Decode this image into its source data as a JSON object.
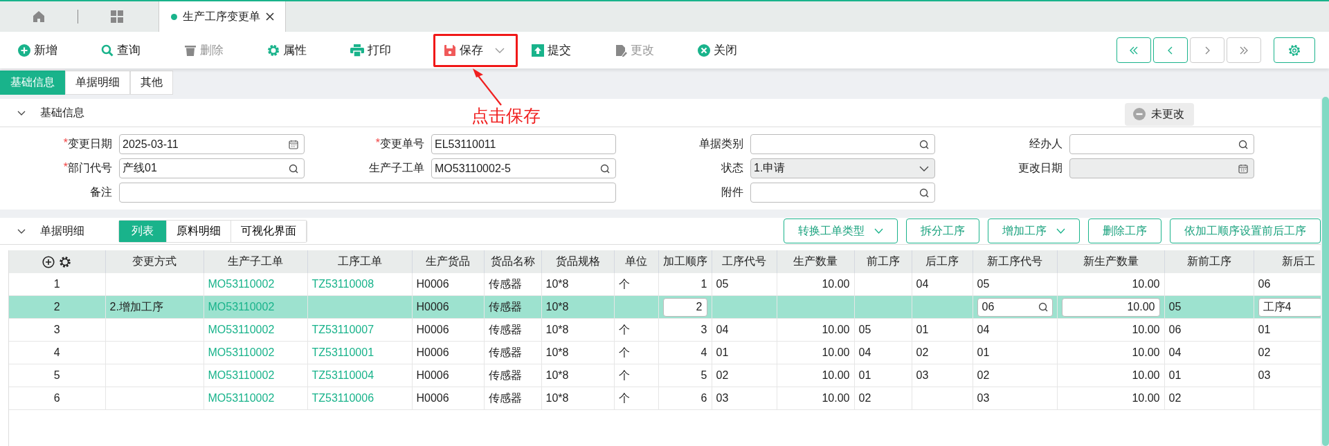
{
  "doc_tabs": [
    {
      "kind": "home",
      "selected": false
    },
    {
      "kind": "grid",
      "selected": false
    },
    {
      "kind": "page",
      "label": "生产工序变更单",
      "selected": true
    }
  ],
  "toolbar": [
    {
      "label": "新增",
      "disabled": false
    },
    {
      "label": "查询",
      "disabled": false
    },
    {
      "label": "删除",
      "disabled": true
    },
    {
      "label": "属性",
      "disabled": false
    },
    {
      "label": "打印",
      "disabled": false
    },
    {
      "label": "保存",
      "disabled": false,
      "dropdown": true,
      "annotated": true
    },
    {
      "label": "提交",
      "disabled": false
    },
    {
      "label": "更改",
      "disabled": true
    },
    {
      "label": "关闭",
      "disabled": false
    }
  ],
  "nav_buttons": [
    {
      "disabled": false
    },
    {
      "disabled": false
    },
    {
      "disabled": true
    },
    {
      "disabled": true
    }
  ],
  "annotation": {
    "text": "点击保存"
  },
  "section_tabs": [
    {
      "label": "基础信息",
      "selected": true
    },
    {
      "label": "单据明细",
      "selected": false
    },
    {
      "label": "其他",
      "selected": false
    }
  ],
  "basic_info": {
    "title": "基础信息",
    "expanded": true,
    "status": "未更改",
    "rows": [
      [
        {
          "required_mark": "*",
          "label": "变更日期",
          "value": "2025-03-11",
          "kind": "date",
          "disabled": false
        },
        {
          "required_mark": "*",
          "label": "变更单号",
          "value": "EL53110011",
          "kind": "text",
          "disabled": false
        },
        {
          "label": "单据类别",
          "kind": "lookup",
          "disabled": false
        },
        {
          "label": "经办人",
          "kind": "lookup",
          "disabled": false
        }
      ],
      [
        {
          "required_mark": "*",
          "label": "部门代号",
          "value": "产线01",
          "kind": "lookup",
          "disabled": false
        },
        {
          "label": "生产子工单",
          "value": "MO53110002-5",
          "kind": "lookup",
          "disabled": false
        },
        {
          "label": "状态",
          "value": "1.申请",
          "kind": "select",
          "disabled": true
        },
        {
          "label": "更改日期",
          "kind": "date",
          "disabled": true
        }
      ],
      [
        {
          "label": "备注",
          "kind": "text",
          "wide": true,
          "disabled": false
        },
        "",
        {
          "label": "附件",
          "kind": "lookup",
          "disabled": false
        }
      ]
    ]
  },
  "detail": {
    "title": "单据明细",
    "expanded": true,
    "view_tabs": [
      {
        "label": "列表",
        "selected": true
      },
      {
        "label": "原料明细",
        "selected": false
      },
      {
        "label": "可视化界面",
        "selected": false
      }
    ],
    "actions": [
      {
        "label": "转换工单类型",
        "dropdown": true
      },
      {
        "label": "拆分工序",
        "dropdown": false
      },
      {
        "label": "增加工序",
        "dropdown": true
      },
      {
        "label": "删除工序",
        "dropdown": false
      },
      {
        "label": "依加工顺序设置前后工序",
        "dropdown": false
      }
    ],
    "columns": [
      {
        "label": "变更方式",
        "kind": "text",
        "editable": false
      },
      {
        "label": "生产子工单",
        "kind": "link",
        "editable": false
      },
      {
        "label": "工序工单",
        "kind": "link",
        "editable": false
      },
      {
        "label": "生产货品",
        "kind": "text",
        "editable": false
      },
      {
        "label": "货品名称",
        "kind": "text",
        "editable": false
      },
      {
        "label": "货品规格",
        "kind": "text",
        "editable": false
      },
      {
        "label": "单位",
        "kind": "text",
        "editable": false
      },
      {
        "label": "加工顺序",
        "kind": "number",
        "editable": true
      },
      {
        "label": "工序代号",
        "kind": "text",
        "editable": false
      },
      {
        "label": "生产数量",
        "kind": "number",
        "editable": false
      },
      {
        "label": "前工序",
        "kind": "text",
        "editable": false
      },
      {
        "label": "后工序",
        "kind": "text",
        "editable": false
      },
      {
        "label": "新工序代号",
        "kind": "lookup",
        "editable": true
      },
      {
        "label": "新生产数量",
        "kind": "number",
        "editable": true
      },
      {
        "label": "新前工序",
        "kind": "text",
        "editable": false
      },
      {
        "label": "新后工",
        "kind": "text",
        "editable": true
      }
    ],
    "rows": [
      {
        "index": "1",
        "selected": false,
        "cells": [
          null,
          "MO53110002",
          "TZ53110008",
          "H0006",
          "传感器",
          "10*8",
          "个",
          "1",
          "05",
          "10.00",
          null,
          "04",
          "05",
          "10.00",
          null,
          "06"
        ]
      },
      {
        "index": "2",
        "selected": true,
        "cells": [
          "2.增加工序",
          "MO53110002",
          null,
          "H0006",
          "传感器",
          "10*8",
          null,
          "2",
          null,
          null,
          null,
          null,
          "06",
          "10.00",
          "05",
          "工序4"
        ]
      },
      {
        "index": "3",
        "selected": false,
        "cells": [
          null,
          "MO53110002",
          "TZ53110007",
          "H0006",
          "传感器",
          "10*8",
          "个",
          "3",
          "04",
          "10.00",
          "05",
          "01",
          "04",
          "10.00",
          "06",
          "01"
        ]
      },
      {
        "index": "4",
        "selected": false,
        "cells": [
          null,
          "MO53110002",
          "TZ53110001",
          "H0006",
          "传感器",
          "10*8",
          "个",
          "4",
          "01",
          "10.00",
          "04",
          "02",
          "01",
          "10.00",
          "04",
          "02"
        ]
      },
      {
        "index": "5",
        "selected": false,
        "cells": [
          null,
          "MO53110002",
          "TZ53110004",
          "H0006",
          "传感器",
          "10*8",
          "个",
          "5",
          "02",
          "10.00",
          "01",
          "03",
          "02",
          "10.00",
          "01",
          "03"
        ]
      },
      {
        "index": "6",
        "selected": false,
        "cells": [
          null,
          "MO53110002",
          "TZ53110006",
          "H0006",
          "传感器",
          "10*8",
          "个",
          "6",
          "03",
          "10.00",
          "02",
          null,
          "03",
          "10.00",
          "02",
          null
        ]
      }
    ]
  }
}
